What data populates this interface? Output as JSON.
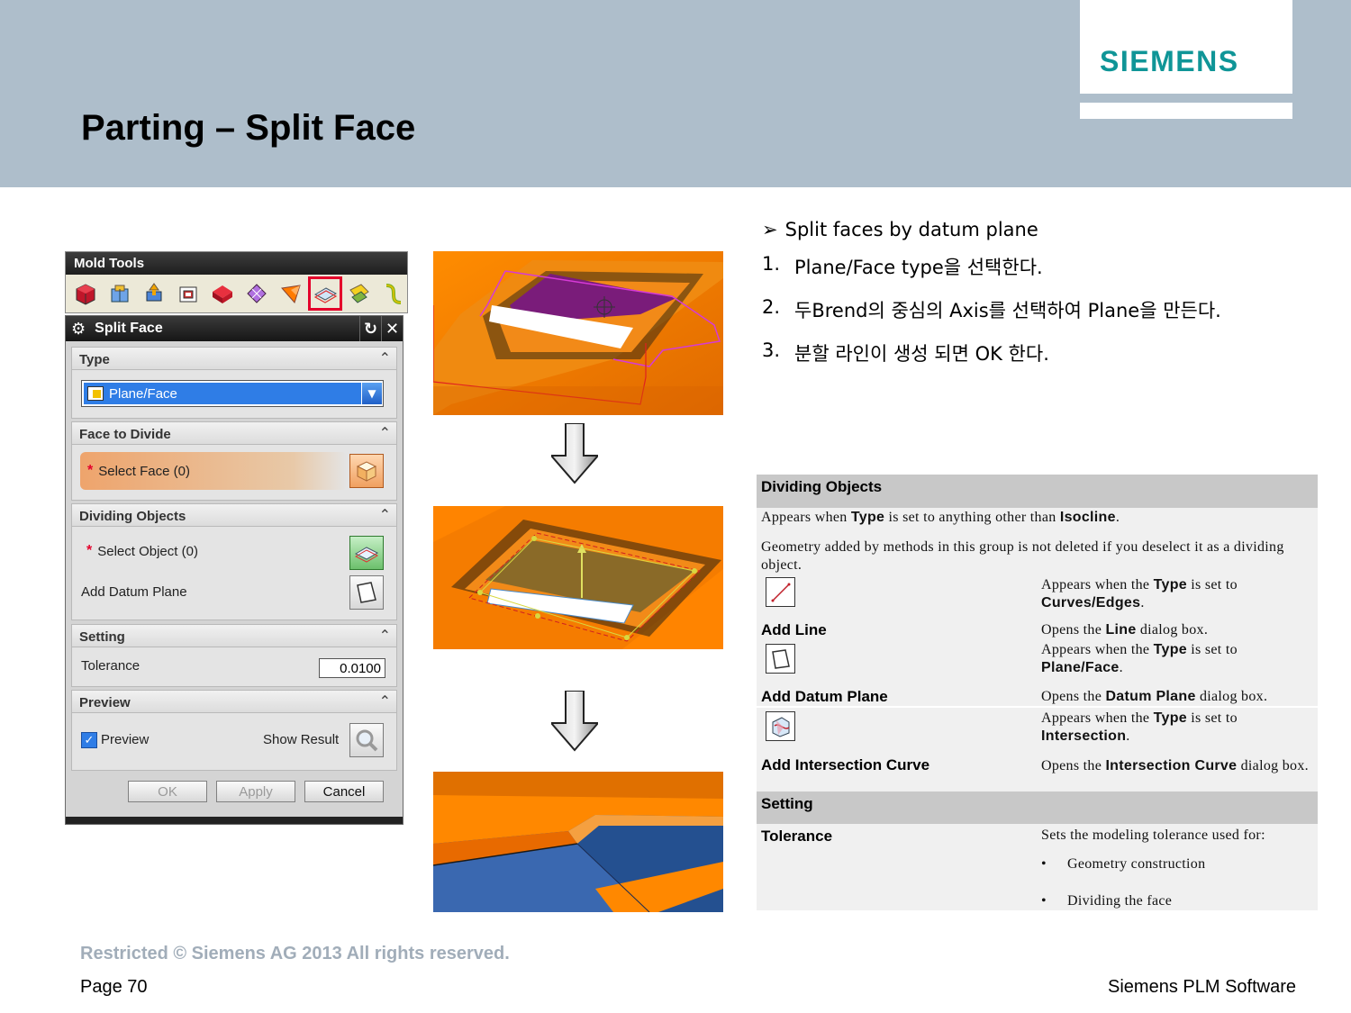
{
  "header": {
    "title": "Parting – Split Face",
    "logo": "SIEMENS",
    "colors": {
      "band": "#aebecb",
      "logo": "#0f9597"
    }
  },
  "mold_tools": {
    "title": "Mold Tools",
    "icons": [
      "mold-wizard-icon",
      "parting-box-icon",
      "patch-icon",
      "core-cavity-icon",
      "solid-red-icon",
      "surface-icon",
      "extend-icon",
      "split-face-icon",
      "trim-icon",
      "curve-icon"
    ],
    "selected_icon": "split-face-icon"
  },
  "dialog": {
    "title": "Split Face",
    "type": {
      "header": "Type",
      "value": "Plane/Face"
    },
    "face": {
      "header": "Face to Divide",
      "select": "Select Face (0)"
    },
    "dividing": {
      "header": "Dividing Objects",
      "select": "Select Object (0)",
      "datum": "Add Datum Plane"
    },
    "setting": {
      "header": "Setting",
      "tolerance_label": "Tolerance",
      "tolerance_value": "0.0100"
    },
    "preview": {
      "header": "Preview",
      "preview_label": "Preview",
      "show_result": "Show Result",
      "preview_checked": true
    },
    "buttons": {
      "ok": "OK",
      "apply": "Apply",
      "cancel": "Cancel"
    }
  },
  "instructions": {
    "heading": "Split faces by datum plane",
    "steps": [
      {
        "num": "1.",
        "text": "Plane/Face type을 선택한다."
      },
      {
        "num": "2.",
        "text": "두Brend의 중심의 Axis를 선택하여 Plane을 만든다."
      },
      {
        "num": "3.",
        "text": "분할 라인이 생성 되면 OK 한다."
      }
    ]
  },
  "reference": {
    "dividing_header": "Dividing Objects",
    "appears_pre": "Appears when ",
    "appears_type": "Type",
    "appears_mid": " is set to anything other than ",
    "appears_iso": "Isocline",
    "appears_end": ".",
    "geometry_note": "Geometry added by methods in this group is not deleted if you deselect it as a dividing object.",
    "rows": [
      {
        "appears": "Appears when the ",
        "type": "Type",
        "is_set": " is set to",
        "value": "Curves/Edges",
        "label": "Add Line",
        "opens_pre": "Opens the ",
        "opens_name": "Line",
        "opens_post": " dialog box."
      },
      {
        "appears": "Appears when the ",
        "type": "Type",
        "is_set": " is set to",
        "value": "Plane/Face",
        "label": "Add Datum Plane",
        "opens_pre": "Opens the ",
        "opens_name": "Datum Plane",
        "opens_post": " dialog box."
      },
      {
        "appears": "Appears when the ",
        "type": "Type",
        "is_set": " is set to",
        "value": "Intersection",
        "label": "Add Intersection Curve",
        "opens_pre": "Opens the ",
        "opens_name": "Intersection Curve",
        "opens_post": " dialog box."
      }
    ],
    "setting_header": "Setting",
    "tolerance_label": "Tolerance",
    "tolerance_desc": "Sets the modeling tolerance used for:",
    "bullets": [
      "Geometry construction",
      "Dividing the face"
    ]
  },
  "footer": {
    "copyright": "Restricted © Siemens AG 2013 All rights reserved.",
    "page": "Page 70",
    "company": "Siemens PLM Software"
  }
}
